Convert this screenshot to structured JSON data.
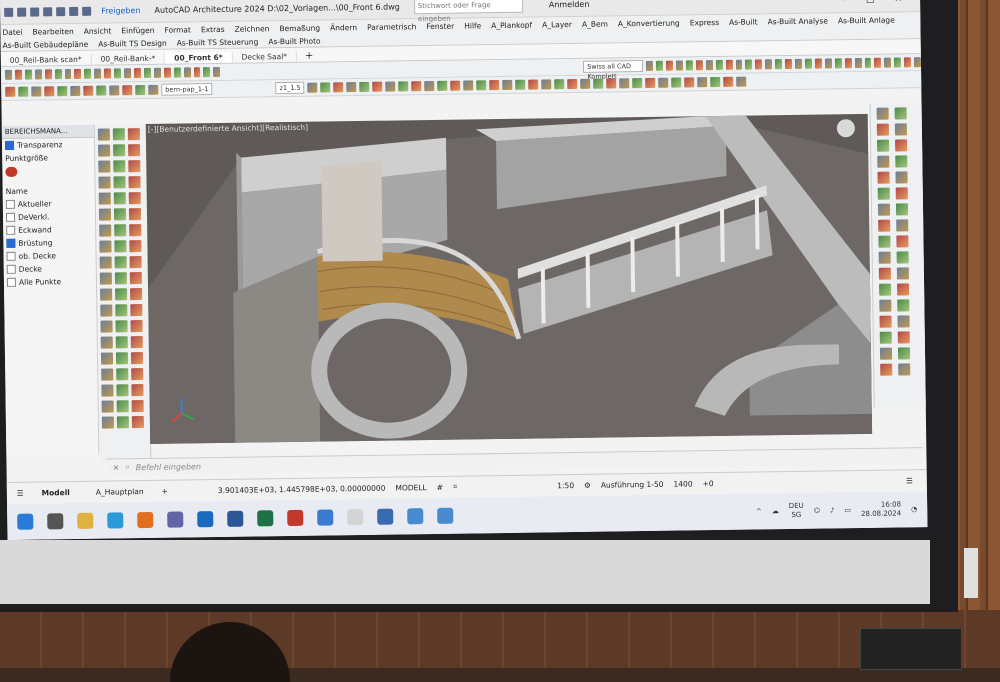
{
  "titlebar": {
    "share_label": "Freigeben",
    "app_title": "AutoCAD Architecture 2024  D:\\02_Vorlagen...\\00_Front 6.dwg",
    "search_placeholder": "Stichwort oder Frage eingeben",
    "signin_label": "Anmelden"
  },
  "ribbon_tabs": [
    "Datei",
    "Bearbeiten",
    "Ansicht",
    "Einfügen",
    "Format",
    "Extras",
    "Zeichnen",
    "Bemaßung",
    "Ändern",
    "Parametrisch",
    "Fenster",
    "Hilfe",
    "A_Plankopf",
    "A_Layer",
    "A_Bem",
    "A_Konvertierung",
    "Express",
    "As-Built",
    "As-Built Analyse",
    "As-Built Anlage"
  ],
  "ribbon_tabs2": [
    "As-Built Gebäudepläne",
    "As-Built TS Design",
    "As-Built TS Steuerung",
    "As-Built Photo"
  ],
  "doc_tabs": [
    {
      "label": "00_Reil-Bank scan*",
      "active": false
    },
    {
      "label": "00_Reil-Bank-*",
      "active": false
    },
    {
      "label": "00_Front 6*",
      "active": true
    },
    {
      "label": "Decke Saal*",
      "active": false
    }
  ],
  "toolbar": {
    "layer_dropdown": "bern-pap_1-1",
    "scale_dropdown": "z1_1.5",
    "workspace_dropdown": "Swiss all CAD Komplett"
  },
  "panel": {
    "header": "BEREICHSMANA...",
    "transparency_label": "Transparenz",
    "pointsize_label": "Punktgröße",
    "name_header": "Name",
    "items": [
      {
        "label": "Aktueller",
        "checked": false
      },
      {
        "label": "DeVerkl.",
        "checked": false
      },
      {
        "label": "Eckwand",
        "checked": false
      },
      {
        "label": "Brüstung",
        "checked": true
      },
      {
        "label": "ob. Decke",
        "checked": false
      },
      {
        "label": "Decke",
        "checked": false
      },
      {
        "label": "Alle Punkte",
        "checked": false
      }
    ]
  },
  "viewport": {
    "label": "[-][Benutzerdefinierte Ansicht][Realistisch]"
  },
  "commandline": {
    "placeholder": "Befehl eingeben"
  },
  "statusbar": {
    "tab_model": "Modell",
    "tab_layout": "A_Hauptplan",
    "coordinates": "3.901403E+03, 1.445798E+03, 0.00000000",
    "model_label": "MODELL",
    "scale": "1:50",
    "detail": "Ausführung 1-50",
    "value": "1400",
    "plus_zero": "+0"
  },
  "tray": {
    "lang": "DEU",
    "region": "SG",
    "time": "16:08",
    "date": "28.08.2024"
  },
  "colors": {
    "accent": "#2a6ad0",
    "viewport_bg": "#5f5a57",
    "stair": "#b08a4c"
  }
}
